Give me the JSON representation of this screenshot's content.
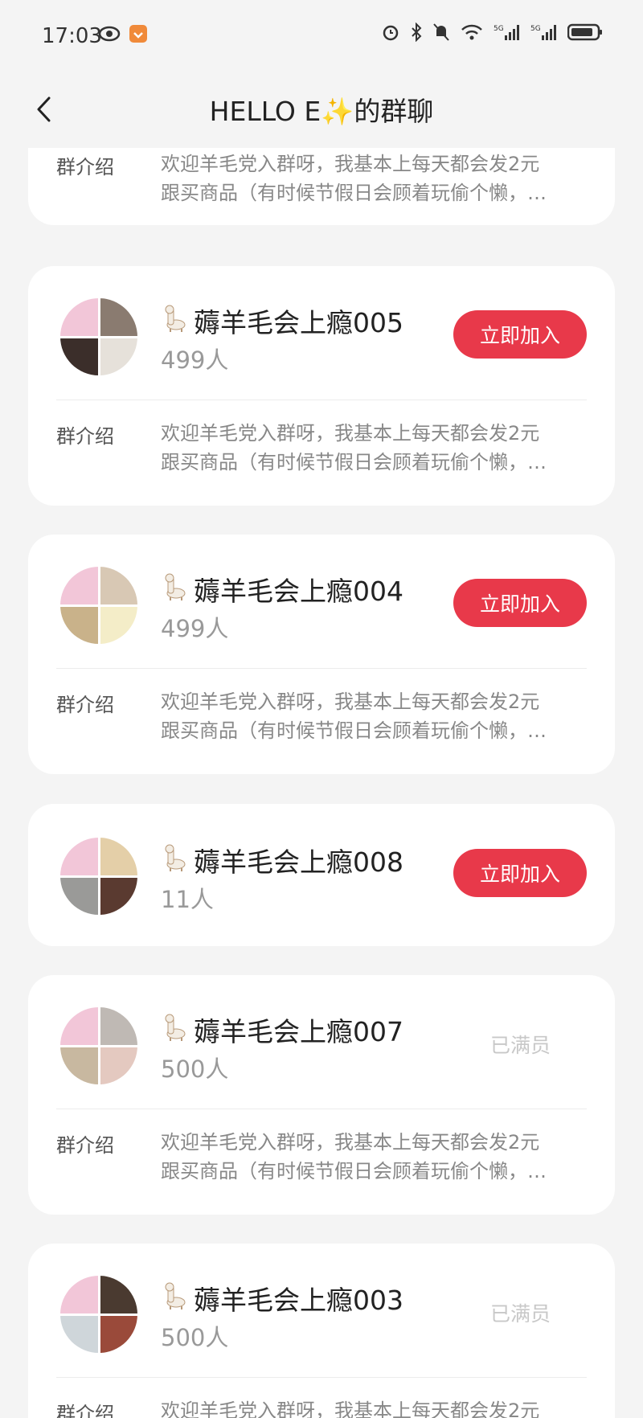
{
  "status_bar": {
    "time": "17:03",
    "left_icons": [
      "eye-icon",
      "app-notification-icon"
    ],
    "right_icons": [
      "alarm-icon",
      "bluetooth-icon",
      "mute-icon",
      "wifi-icon",
      "signal-5g-icon",
      "signal-5g-icon",
      "battery-icon"
    ]
  },
  "nav": {
    "back_icon": "chevron-left-icon",
    "title": "HELLO E✨的群聊"
  },
  "intro_label": "群介绍",
  "intro_line1": "欢迎羊毛党入群呀，我基本上每天都会发2元",
  "intro_line2": "跟买商品（有时候节假日会顾着玩偷个懒，…",
  "join_label": "立即加入",
  "full_label": "已满员",
  "groups": [
    {
      "name": "薅羊毛会上瘾005",
      "count": "499人",
      "status": "join"
    },
    {
      "name": "薅羊毛会上瘾004",
      "count": "499人",
      "status": "join"
    },
    {
      "name": "薅羊毛会上瘾008",
      "count": "11人",
      "status": "join"
    },
    {
      "name": "薅羊毛会上瘾007",
      "count": "500人",
      "status": "full"
    },
    {
      "name": "薅羊毛会上瘾003",
      "count": "500人",
      "status": "full"
    }
  ],
  "colors": {
    "accent": "#e8394a",
    "background": "#f4f4f4",
    "card": "#ffffff"
  }
}
